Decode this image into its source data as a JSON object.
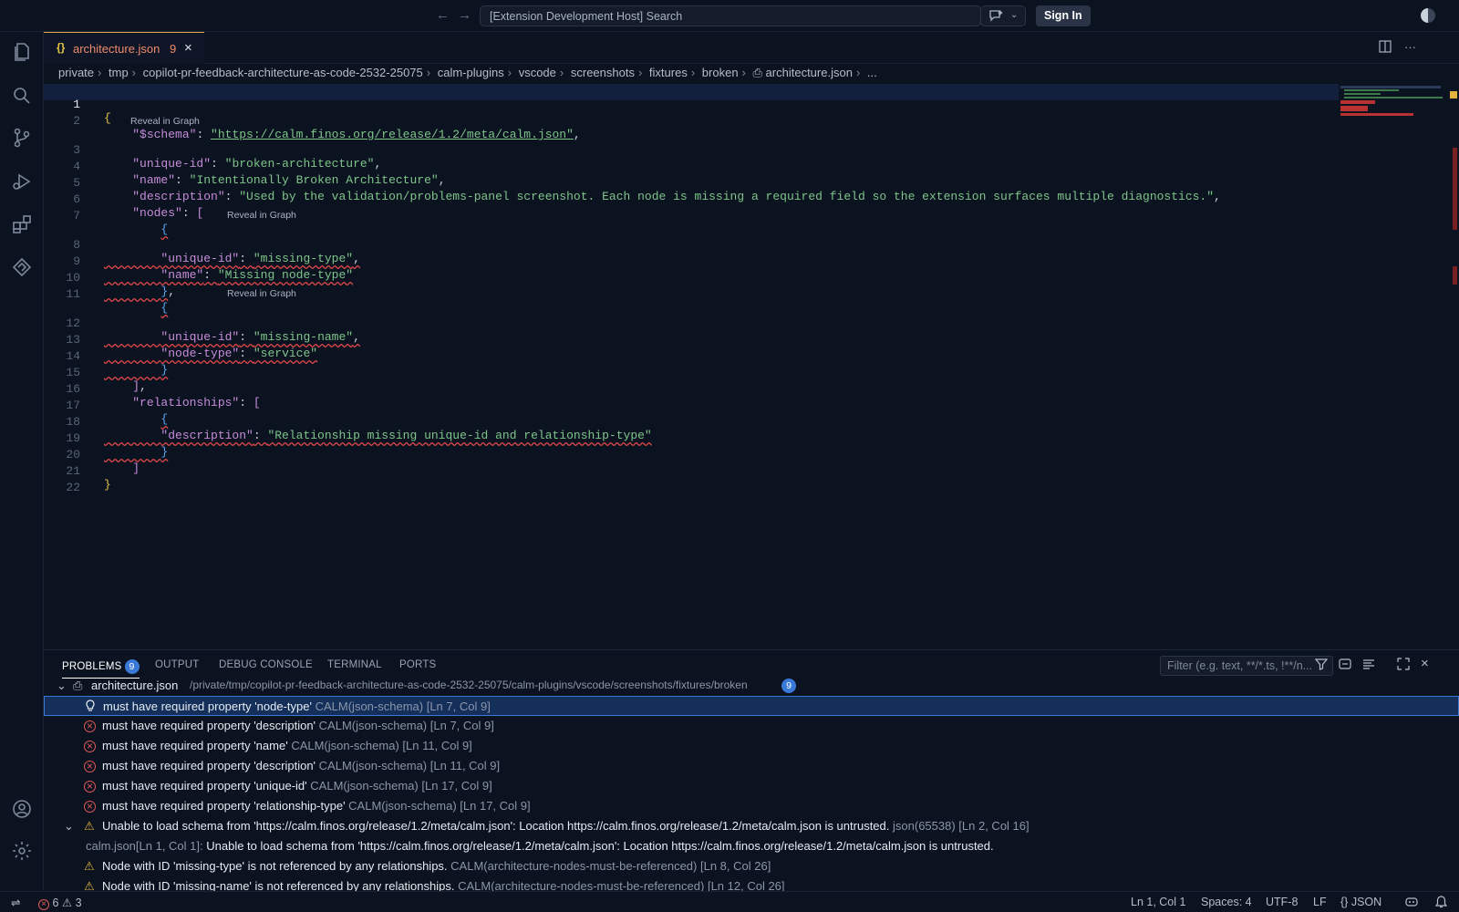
{
  "titlebar": {
    "back_icon": "arrow-left-icon",
    "forward_icon": "arrow-right-icon",
    "search_text": "[Extension Development Host] Search",
    "signin_label": "Sign In"
  },
  "activity_bar": [
    "files-icon",
    "search-icon",
    "source-control-icon",
    "run-debug-icon",
    "extensions-icon",
    "calm-icon",
    "account-icon",
    "gear-icon"
  ],
  "tab": {
    "name": "architecture.json",
    "problem_count": "9"
  },
  "breadcrumb": [
    "private",
    "tmp",
    "copilot-pr-feedback-architecture-as-code-2532-25075",
    "calm-plugins",
    "vscode",
    "screenshots",
    "fixtures",
    "broken",
    "architecture.json",
    "..."
  ],
  "editor": {
    "lens_label": "Reveal in Graph",
    "line_numbers": [
      "1",
      "2",
      "3",
      "4",
      "5",
      "6",
      "7",
      "8",
      "9",
      "10",
      "11",
      "12",
      "13",
      "14",
      "15",
      "16",
      "17",
      "18",
      "19",
      "20",
      "21",
      "22"
    ],
    "schema_key": "\"$schema\"",
    "schema_val": "\"https://calm.finos.org/release/1.2/meta/calm.json\"",
    "uid_key": "\"unique-id\"",
    "uid_val": "\"broken-architecture\"",
    "name_key": "\"name\"",
    "name_val": "\"Intentionally Broken Architecture\"",
    "desc_key": "\"description\"",
    "desc_val": "\"Used by the validation/problems-panel screenshot. Each node is missing a required field so the extension surfaces multiple diagnostics.\"",
    "nodes_key": "\"nodes\"",
    "n1_uid_val": "\"missing-type\"",
    "n1_name_val": "\"Missing node-type\"",
    "n2_uid_val": "\"missing-name\"",
    "n2_type_key": "\"node-type\"",
    "n2_type_val": "\"service\"",
    "rels_key": "\"relationships\"",
    "r1_desc_val": "\"Relationship missing unique-id and relationship-type\""
  },
  "panel": {
    "tabs": [
      "PROBLEMS",
      "OUTPUT",
      "DEBUG CONSOLE",
      "TERMINAL",
      "PORTS"
    ],
    "problems_badge": "9",
    "filter_placeholder": "Filter (e.g. text, **/*.ts, !**/n...",
    "file_name": "architecture.json",
    "file_path": "/private/tmp/copilot-pr-feedback-architecture-as-code-2532-25075/calm-plugins/vscode/screenshots/fixtures/broken",
    "file_count": "9",
    "problems": [
      {
        "severity": "hint",
        "message": "must have required property 'node-type'",
        "source": "CALM(json-schema)",
        "location": "[Ln 7, Col 9]"
      },
      {
        "severity": "error",
        "message": "must have required property 'description'",
        "source": "CALM(json-schema)",
        "location": "[Ln 7, Col 9]"
      },
      {
        "severity": "error",
        "message": "must have required property 'name'",
        "source": "CALM(json-schema)",
        "location": "[Ln 11, Col 9]"
      },
      {
        "severity": "error",
        "message": "must have required property 'description'",
        "source": "CALM(json-schema)",
        "location": "[Ln 11, Col 9]"
      },
      {
        "severity": "error",
        "message": "must have required property 'unique-id'",
        "source": "CALM(json-schema)",
        "location": "[Ln 17, Col 9]"
      },
      {
        "severity": "error",
        "message": "must have required property 'relationship-type'",
        "source": "CALM(json-schema)",
        "location": "[Ln 17, Col 9]"
      },
      {
        "severity": "warning",
        "message": "Unable to load schema from 'https://calm.finos.org/release/1.2/meta/calm.json': Location https://calm.finos.org/release/1.2/meta/calm.json is untrusted.",
        "source": "json(65538)",
        "location": "[Ln 2, Col 16]"
      },
      {
        "severity": "related",
        "prefix": "calm.json[Ln 1, Col 1]:",
        "message": "Unable to load schema from 'https://calm.finos.org/release/1.2/meta/calm.json': Location https://calm.finos.org/release/1.2/meta/calm.json is untrusted."
      },
      {
        "severity": "warning",
        "message": "Node with ID 'missing-type' is not referenced by any relationships.",
        "source": "CALM(architecture-nodes-must-be-referenced)",
        "location": "[Ln 8, Col 26]"
      },
      {
        "severity": "warning",
        "message": "Node with ID 'missing-name' is not referenced by any relationships.",
        "source": "CALM(architecture-nodes-must-be-referenced)",
        "location": "[Ln 12, Col 26]"
      }
    ]
  },
  "statusbar": {
    "errors": "6",
    "warnings": "3",
    "position": "Ln 1, Col 1",
    "spaces": "Spaces: 4",
    "encoding": "UTF-8",
    "eol": "LF",
    "language": "JSON"
  }
}
